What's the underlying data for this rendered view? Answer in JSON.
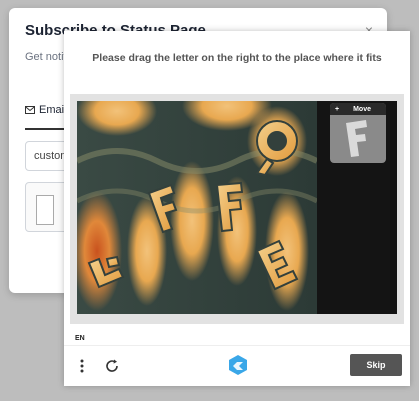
{
  "subscribe": {
    "title": "Subscribe to Status Page",
    "close": "×",
    "description": "Get notified when resolved",
    "tab_label": "Email",
    "email_value": "customer@"
  },
  "captcha": {
    "prompt": "Please drag the letter on the right to the place where it fits",
    "move_label": "Move",
    "language": "EN",
    "skip_label": "Skip"
  },
  "colors": {
    "skip_bg": "#555555",
    "panel_bg": "#e2e2e2",
    "brand": "#3aa7e8"
  },
  "icons": [
    "email-icon",
    "close-icon",
    "menu-icon",
    "refresh-icon",
    "brand-logo-icon",
    "move-icon"
  ]
}
